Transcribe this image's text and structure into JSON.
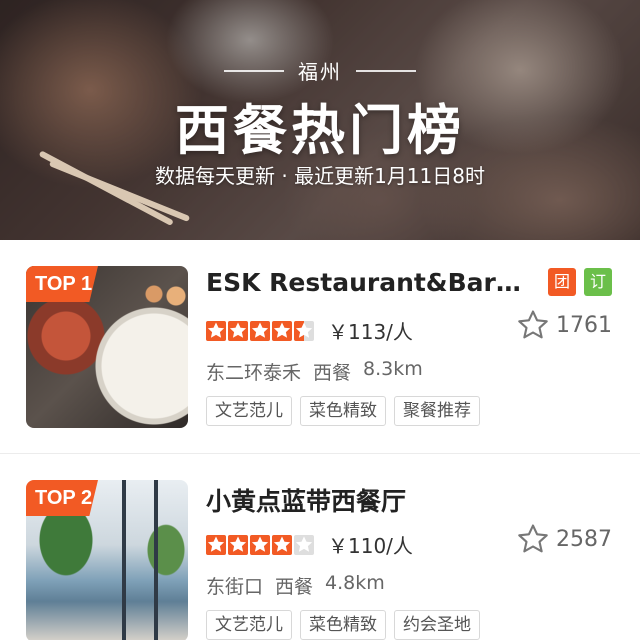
{
  "header": {
    "city": "福州",
    "title": "西餐热门榜",
    "subtitle": "数据每天更新 · 最近更新1月11日8时"
  },
  "colors": {
    "accent": "#f25a24",
    "green_tag": "#6bbf4a"
  },
  "restaurants": [
    {
      "rank_badge": "TOP 1",
      "name": "ESK Restaurant&Bar ...",
      "deal_tags": [
        "团",
        "订"
      ],
      "rating_stars": 4.5,
      "price": "￥113/人",
      "favorites": "1761",
      "area": "东二环泰禾",
      "cuisine": "西餐",
      "distance": "8.3km",
      "labels": [
        "文艺范儿",
        "菜色精致",
        "聚餐推荐"
      ],
      "thumbnail_icon": "food-photo"
    },
    {
      "rank_badge": "TOP 2",
      "name": "小黄点蓝带西餐厅",
      "deal_tags": [],
      "rating_stars": 4,
      "price": "￥110/人",
      "favorites": "2587",
      "area": "东街口",
      "cuisine": "西餐",
      "distance": "4.8km",
      "labels": [
        "文艺范儿",
        "菜色精致",
        "约会圣地"
      ],
      "thumbnail_icon": "interior-photo"
    }
  ]
}
